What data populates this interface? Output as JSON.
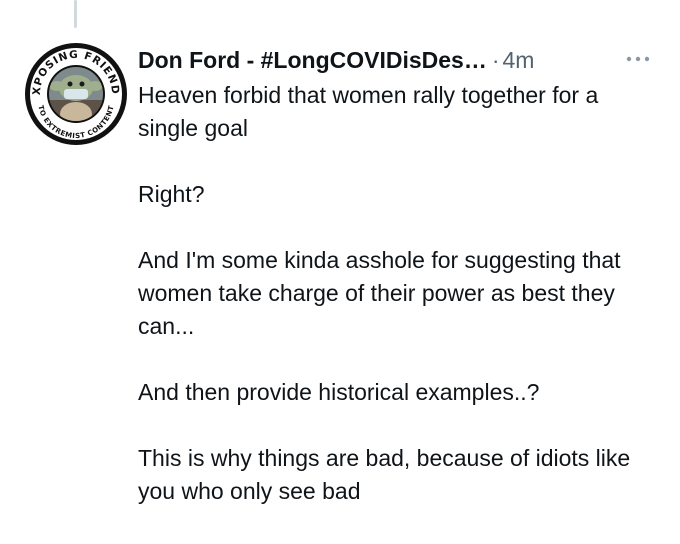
{
  "tweet": {
    "author": {
      "display_name": "Don Ford - #LongCOVIDisDes…",
      "avatar_badge_top": "EXPOSING FRIENDS",
      "avatar_badge_bottom": "TO EXTREMIST CONTENT"
    },
    "separator": "·",
    "timestamp": "4m",
    "paragraphs": [
      "Heaven forbid that women rally together for a single goal",
      "Right?",
      "And I'm some kinda asshole for suggesting that women take charge of their power as best they can...",
      "And then provide historical examples..?",
      "This is why things are bad, because of idiots like you who only see bad"
    ]
  },
  "colors": {
    "text": "#0f1419",
    "secondary": "#536471",
    "thread_line": "#cfd9de"
  },
  "icons": {
    "more": "more-horizontal-icon",
    "avatar": "exposing-friends-badge"
  }
}
